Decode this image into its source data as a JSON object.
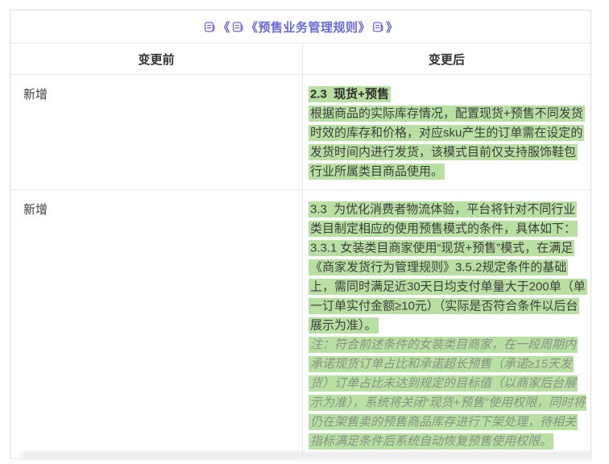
{
  "colors": {
    "accent": "#6969d7",
    "highlight": "#b8e0a2",
    "border_outer": "#dedede",
    "border_inner": "#e7e7e7",
    "note_text": "#879184"
  },
  "title": {
    "seg1": "《",
    "seg2": "《预售业务管理规则》",
    "seg3": "》",
    "icon": "document-icon"
  },
  "table": {
    "headers": {
      "before": "变更前",
      "after": "变更后"
    },
    "rows": [
      {
        "before": "新增",
        "after": {
          "heading": "2.3  现货+预售",
          "paragraph": "根据商品的实际库存情况，配置现货+预售不同发货时效的库存和价格，对应sku产生的订单需在设定的发货时间内进行发货，该模式目前仅支持服饰鞋包行业所属类目商品使用。"
        }
      },
      {
        "before": "新增",
        "after": {
          "paragraph1": "3.3  为优化消费者物流体验，平台将针对不同行业类目制定相应的使用预售模式的条件，具体如下：",
          "paragraph2": "3.3.1 女装类目商家使用“现货+预售”模式，在满足《商家发货行为管理规则》3.5.2规定条件的基础上，需同时满足近30天日均支付单量大于200单（单一订单实付金额≥10元）（实际是否符合条件以后台展示为准）。",
          "note": "注：符合前述条件的女装类目商家，在一段周期内承诺现货订单占比和承诺超长预售（承诺≥15天发货）订单占比未达到规定的目标值（以商家后台展示为准），系统将关闭“现货+预售”使用权限，同时将仍在架售卖的预售商品库存进行下架处理，待相关指标满足条件后系统自动恢复预售使用权限。"
        }
      }
    ]
  }
}
